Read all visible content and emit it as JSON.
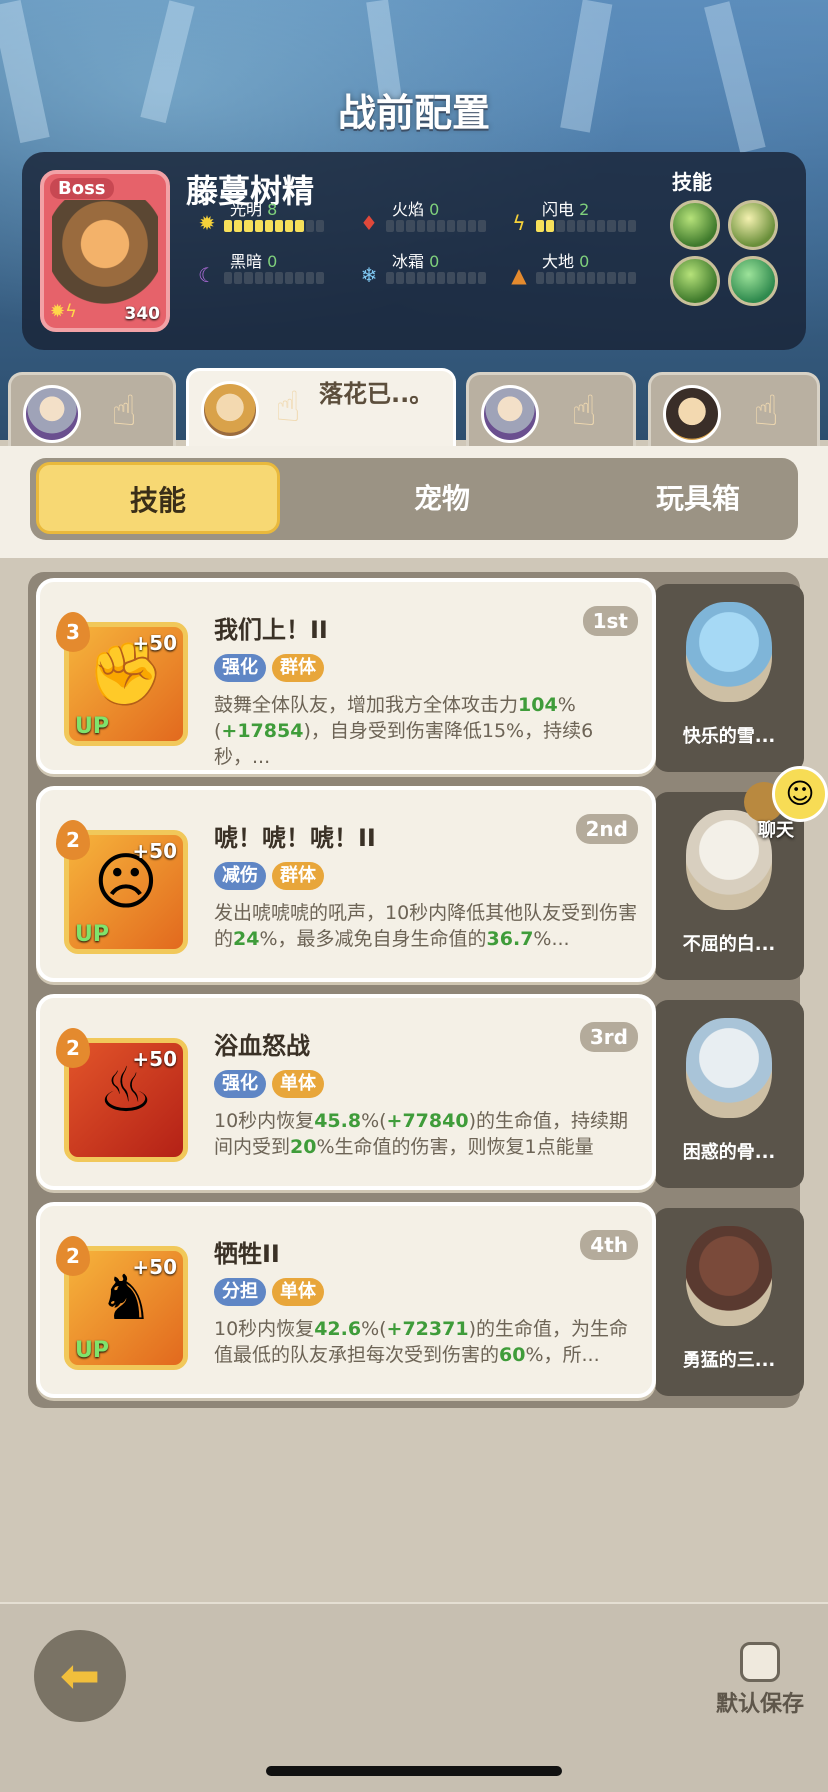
{
  "page_title": "战前配置",
  "boss": {
    "tag": "Boss",
    "name": "藤蔓树精",
    "level": "340",
    "elements": [
      {
        "name": "光明",
        "value": "8",
        "icon": "sun-icon",
        "filled": 8
      },
      {
        "name": "火焰",
        "value": "0",
        "icon": "fire-icon",
        "filled": 0
      },
      {
        "name": "闪电",
        "value": "2",
        "icon": "lightning-icon",
        "filled": 2
      },
      {
        "name": "黑暗",
        "value": "0",
        "icon": "moon-icon",
        "filled": 0
      },
      {
        "name": "冰霜",
        "value": "0",
        "icon": "snowflake-icon",
        "filled": 0
      },
      {
        "name": "大地",
        "value": "0",
        "icon": "earth-icon",
        "filled": 0
      }
    ],
    "skills_label": "技能"
  },
  "hero_tabs": [
    {
      "name": "",
      "active": false
    },
    {
      "name": "落花已..。",
      "active": true
    },
    {
      "name": "",
      "active": false
    },
    {
      "name": "",
      "active": false
    }
  ],
  "segment_tabs": [
    "技能",
    "宠物",
    "玩具箱"
  ],
  "skills": [
    {
      "level": "3",
      "plus": "+50",
      "up": "UP",
      "name": "我们上！II",
      "rank": "1st",
      "tags": [
        {
          "text": "强化",
          "color": "blue"
        },
        {
          "text": "群体",
          "color": "orange"
        }
      ],
      "desc_parts": [
        "鼓舞全体队友，增加我方全体攻击力",
        "104",
        "%(",
        "+17854",
        ")，自身受到伤害降低15%，持续6秒，..."
      ],
      "pet": "快乐的雪..."
    },
    {
      "level": "2",
      "plus": "+50",
      "up": "UP",
      "name": "唬！唬！唬！II",
      "rank": "2nd",
      "tags": [
        {
          "text": "减伤",
          "color": "blue"
        },
        {
          "text": "群体",
          "color": "orange"
        }
      ],
      "desc_parts": [
        "发出唬唬唬的吼声，10秒内降低其他队友受到伤害的",
        "24",
        "%，最多减免自身生命值的",
        "36.7",
        "%..."
      ],
      "pet": "不屈的白..."
    },
    {
      "level": "2",
      "plus": "+50",
      "up": "",
      "name": "浴血怒战",
      "rank": "3rd",
      "tags": [
        {
          "text": "强化",
          "color": "blue"
        },
        {
          "text": "单体",
          "color": "orange"
        }
      ],
      "desc_parts": [
        "10秒内恢复",
        "45.8",
        "%(",
        "+77840",
        ")的生命值，持续期间内受到",
        "20",
        "%生命值的伤害，则恢复1点能量"
      ],
      "pet": "困惑的骨..."
    },
    {
      "level": "2",
      "plus": "+50",
      "up": "UP",
      "name": "牺牲II",
      "rank": "4th",
      "tags": [
        {
          "text": "分担",
          "color": "blue"
        },
        {
          "text": "单体",
          "color": "orange"
        }
      ],
      "desc_parts": [
        "10秒内恢复",
        "42.6",
        "%(",
        "+72371",
        ")的生命值，为生命值最低的队友承担每次受到伤害的",
        "60",
        "%，所..."
      ],
      "pet": "勇猛的三..."
    }
  ],
  "chat_label": "聊天",
  "footer": {
    "save_label": "默认保存"
  }
}
